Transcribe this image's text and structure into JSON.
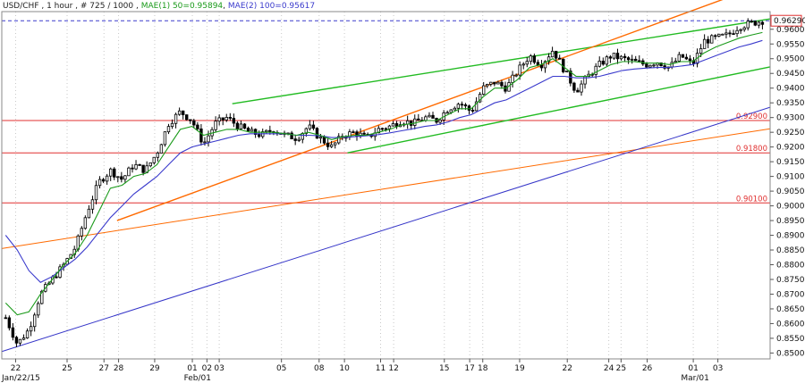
{
  "header": {
    "symbol": "USD/CHF",
    "timeframe": "1 hour",
    "bar_counter": "# 725 / 1000",
    "ma1_label": "MAE(1) 50=0.95894",
    "ma2_label": "MAE(2) 100=0.95617"
  },
  "colors": {
    "background": "#ffffff",
    "candle_up": "#000000",
    "candle_down": "#000000",
    "ma1": "#1a9a1a",
    "ma2": "#3a3acc",
    "channel": "#22bb22",
    "orange": "#ff6a00",
    "blue_trend": "#3535c8",
    "horizontal_level": "#e03030",
    "current_price_line": "#3a3acc"
  },
  "chart_data": {
    "type": "candlestick",
    "y_axis": {
      "min": 0.848,
      "max": 0.966,
      "tick_step": 0.005,
      "ticks": [
        "0.96000",
        "0.95500",
        "0.95000",
        "0.94500",
        "0.94000",
        "0.93500",
        "0.93000",
        "0.92500",
        "0.92000",
        "0.91500",
        "0.91000",
        "0.90500",
        "0.90000",
        "0.89500",
        "0.89000",
        "0.88500",
        "0.88000",
        "0.87500",
        "0.87000",
        "0.86500",
        "0.86000",
        "0.85500",
        "0.85000"
      ]
    },
    "x_axis": {
      "ticks": [
        "22",
        "25",
        "27",
        "28",
        "29",
        "01",
        "02",
        "03",
        "05",
        "08",
        "10",
        "11",
        "12",
        "15",
        "17",
        "18",
        "19",
        "22",
        "24",
        "25",
        "26",
        "01",
        "03"
      ],
      "secondary_labels": [
        "Jan/22/15",
        "Feb/01",
        "Mar/01"
      ]
    },
    "current_price": "0.96290",
    "horizontal_levels": [
      "0.92900",
      "0.91800",
      "0.90100"
    ],
    "price_path": [
      0.862,
      0.853,
      0.858,
      0.87,
      0.875,
      0.88,
      0.886,
      0.898,
      0.908,
      0.912,
      0.909,
      0.914,
      0.912,
      0.918,
      0.928,
      0.932,
      0.929,
      0.921,
      0.928,
      0.93,
      0.927,
      0.925,
      0.924,
      0.926,
      0.924,
      0.923,
      0.927,
      0.923,
      0.92,
      0.924,
      0.925,
      0.923,
      0.926,
      0.927,
      0.929,
      0.928,
      0.93,
      0.929,
      0.933,
      0.935,
      0.932,
      0.94,
      0.942,
      0.94,
      0.946,
      0.951,
      0.948,
      0.953,
      0.946,
      0.939,
      0.944,
      0.948,
      0.951,
      0.95,
      0.949,
      0.948,
      0.949,
      0.947,
      0.951,
      0.948,
      0.956,
      0.957,
      0.958,
      0.961,
      0.962,
      0.9629
    ],
    "ma_fast_path": [
      0.867,
      0.863,
      0.864,
      0.87,
      0.875,
      0.88,
      0.884,
      0.89,
      0.898,
      0.906,
      0.907,
      0.91,
      0.911,
      0.914,
      0.92,
      0.926,
      0.927,
      0.924,
      0.925,
      0.926,
      0.926,
      0.925,
      0.925,
      0.925,
      0.9245,
      0.924,
      0.925,
      0.924,
      0.9225,
      0.9235,
      0.924,
      0.924,
      0.925,
      0.926,
      0.9275,
      0.928,
      0.929,
      0.929,
      0.931,
      0.933,
      0.933,
      0.937,
      0.94,
      0.94,
      0.943,
      0.947,
      0.948,
      0.95,
      0.947,
      0.944,
      0.944,
      0.946,
      0.948,
      0.949,
      0.949,
      0.9485,
      0.9485,
      0.948,
      0.949,
      0.949,
      0.952,
      0.954,
      0.9555,
      0.957,
      0.958,
      0.9589
    ],
    "ma_slow_path": [
      0.89,
      0.885,
      0.878,
      0.874,
      0.876,
      0.879,
      0.882,
      0.886,
      0.891,
      0.896,
      0.9,
      0.904,
      0.907,
      0.91,
      0.914,
      0.918,
      0.92,
      0.921,
      0.922,
      0.923,
      0.924,
      0.9245,
      0.9245,
      0.9245,
      0.9245,
      0.924,
      0.924,
      0.9238,
      0.9232,
      0.9232,
      0.9235,
      0.9238,
      0.9242,
      0.9248,
      0.9255,
      0.9262,
      0.927,
      0.9275,
      0.9285,
      0.93,
      0.931,
      0.933,
      0.935,
      0.936,
      0.938,
      0.94,
      0.942,
      0.944,
      0.944,
      0.9435,
      0.9435,
      0.944,
      0.945,
      0.946,
      0.9465,
      0.9468,
      0.947,
      0.947,
      0.9475,
      0.948,
      0.9495,
      0.951,
      0.9525,
      0.954,
      0.955,
      0.9562
    ],
    "trendlines": [
      {
        "color_key": "channel",
        "from": [
          0.3,
          0.9347
        ],
        "to": [
          1.0,
          0.9635
        ]
      },
      {
        "color_key": "channel",
        "from": [
          0.45,
          0.918
        ],
        "to": [
          1.0,
          0.9472
        ]
      },
      {
        "color_key": "orange",
        "from": [
          0.15,
          0.895
        ],
        "to": [
          1.0,
          0.976
        ]
      },
      {
        "color_key": "orange",
        "from": [
          0.0,
          0.8855
        ],
        "to": [
          1.0,
          0.9262
        ]
      },
      {
        "color_key": "blue_trend",
        "from": [
          0.0,
          0.8505
        ],
        "to": [
          1.0,
          0.9335
        ]
      }
    ]
  }
}
